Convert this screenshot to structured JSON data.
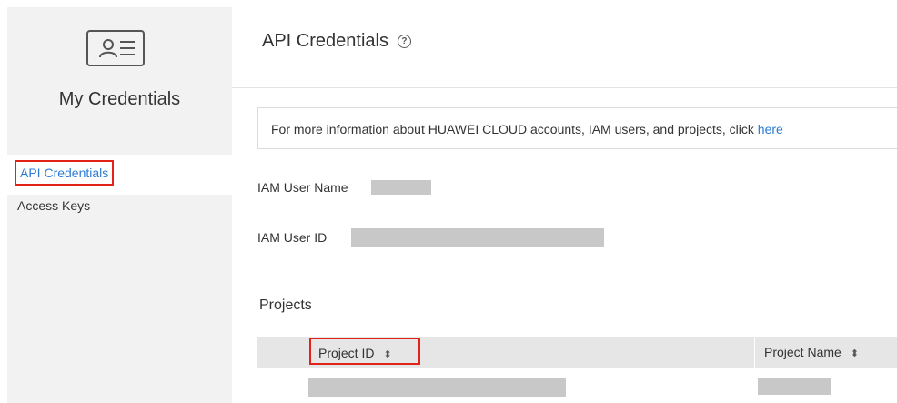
{
  "sidebar": {
    "title": "My Credentials",
    "items": [
      {
        "label": "API Credentials",
        "active": true
      },
      {
        "label": "Access Keys",
        "active": false
      }
    ]
  },
  "main": {
    "title": "API Credentials",
    "info": {
      "text": "For more information about HUAWEI CLOUD accounts, IAM users, and projects, click ",
      "link": "here"
    },
    "fields": [
      {
        "label": "IAM User Name",
        "value_masked": true
      },
      {
        "label": "IAM User ID",
        "value_masked": true
      }
    ],
    "projects": {
      "title": "Projects",
      "columns": [
        "Project ID",
        "Project Name"
      ],
      "rows_masked": 1
    }
  },
  "colors": {
    "accent": "#2b7cd3",
    "highlight": "#e2231a",
    "mask": "#c8c8c8"
  }
}
